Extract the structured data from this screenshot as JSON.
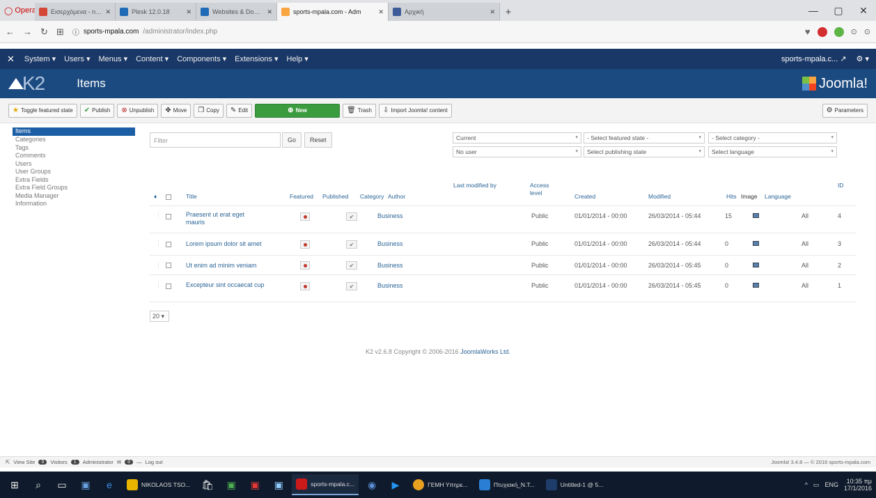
{
  "browser": {
    "brand": "Opera",
    "tabs": [
      {
        "label": "Εισερχόμενα - nikostso",
        "color": "#d44638"
      },
      {
        "label": "Plesk 12.0.18",
        "color": "#1f6bb5"
      },
      {
        "label": "Websites & Domains - Pl",
        "color": "#1f6bb5"
      },
      {
        "label": "sports-mpala.com - Adm",
        "color": "#f9a541",
        "active": true
      },
      {
        "label": "Αρχική",
        "color": "#3d5a99"
      }
    ],
    "new_tab": "+",
    "window_controls": [
      "—",
      "▢",
      "✕"
    ],
    "url_host": "sports-mpala.com",
    "url_path": "/administrator/index.php"
  },
  "admin_menu": {
    "items": [
      "System",
      "Users",
      "Menus",
      "Content",
      "Components",
      "Extensions",
      "Help"
    ],
    "site_name": "sports-mpala.c...",
    "user_icon": "gear-icon"
  },
  "header": {
    "page_title": "Items",
    "k2_text": "K2",
    "joomla_text": "Joomla!"
  },
  "toolbar": {
    "toggle": "Toggle featured state",
    "publish": "Publish",
    "unpublish": "Unpublish",
    "move": "Move",
    "copy": "Copy",
    "edit": "Edit",
    "new": "New",
    "trash": "Trash",
    "import": "Import Joomla! content",
    "parameters": "Parameters"
  },
  "sidebar": [
    "Items",
    "Categories",
    "Tags",
    "Comments",
    "Users",
    "User Groups",
    "Extra Fields",
    "Extra Field Groups",
    "Media Manager",
    "Information"
  ],
  "filters": {
    "search_placeholder": "Filter",
    "go": "Go",
    "reset": "Reset",
    "select_trash": "Current",
    "select_featured": "- Select featured state -",
    "select_category": "- Select category -",
    "select_user": "No user",
    "select_publishing": "Select publishing state",
    "select_language": "Select language"
  },
  "table": {
    "headers": {
      "order": "♦",
      "title": "Title",
      "featured": "Featured",
      "published": "Published",
      "category": "Category",
      "author": "Author",
      "last_modified_by": "Last modified by",
      "access": "Access level",
      "created": "Created",
      "modified": "Modified",
      "hits": "Hits",
      "image": "Image",
      "language": "Language",
      "id": "ID"
    },
    "rows": [
      {
        "title": "Praesent ut erat eget mauris",
        "category": "Business",
        "access": "Public",
        "created": "01/01/2014 - 00:00",
        "modified": "26/03/2014 - 05:44",
        "hits": "15",
        "language": "All",
        "id": "4"
      },
      {
        "title": "Lorem ipsum dolor sit amet",
        "category": "Business",
        "access": "Public",
        "created": "01/01/2014 - 00:00",
        "modified": "26/03/2014 - 05:44",
        "hits": "0",
        "language": "All",
        "id": "3"
      },
      {
        "title": "Ut enim ad minim veniam",
        "category": "Business",
        "access": "Public",
        "created": "01/01/2014 - 00:00",
        "modified": "26/03/2014 - 05:45",
        "hits": "0",
        "language": "All",
        "id": "2"
      },
      {
        "title": "Excepteur sint occaecat cup",
        "category": "Business",
        "access": "Public",
        "created": "01/01/2014 - 00:00",
        "modified": "26/03/2014 - 05:45",
        "hits": "0",
        "language": "All",
        "id": "1"
      }
    ]
  },
  "pager": {
    "limit": "20"
  },
  "footer": {
    "prefix": "K2 v2.6.8 Copyright © 2006-2016 ",
    "link": "JoomlaWorks Ltd."
  },
  "statusbar": {
    "view_site": "View Site",
    "visitors": "Visitors",
    "admins": "Administrator",
    "logout": "Log out",
    "visitors_count": "0",
    "admins_count": "1",
    "messages_count": "0",
    "right": "Joomla! 3.4.8 — © 2016 sports-mpala.com"
  },
  "taskbar": {
    "apps": [
      {
        "label": "NIKOLAOS TSO...",
        "color": "#e8b400"
      },
      {
        "label": "sports-mpala.c...",
        "color": "#cc1a1a",
        "open": true
      },
      {
        "label": "ΓΕΜΗ Υπηρε...",
        "color": "#e8a020"
      },
      {
        "label": "Πτυχιακή_Ν.Τ...",
        "color": "#2a7fd4"
      },
      {
        "label": "Untitled-1 @ 5...",
        "color": "#1f3d6b"
      }
    ],
    "lang": "ENG",
    "time": "10:35 πμ",
    "date": "17/1/2016"
  }
}
